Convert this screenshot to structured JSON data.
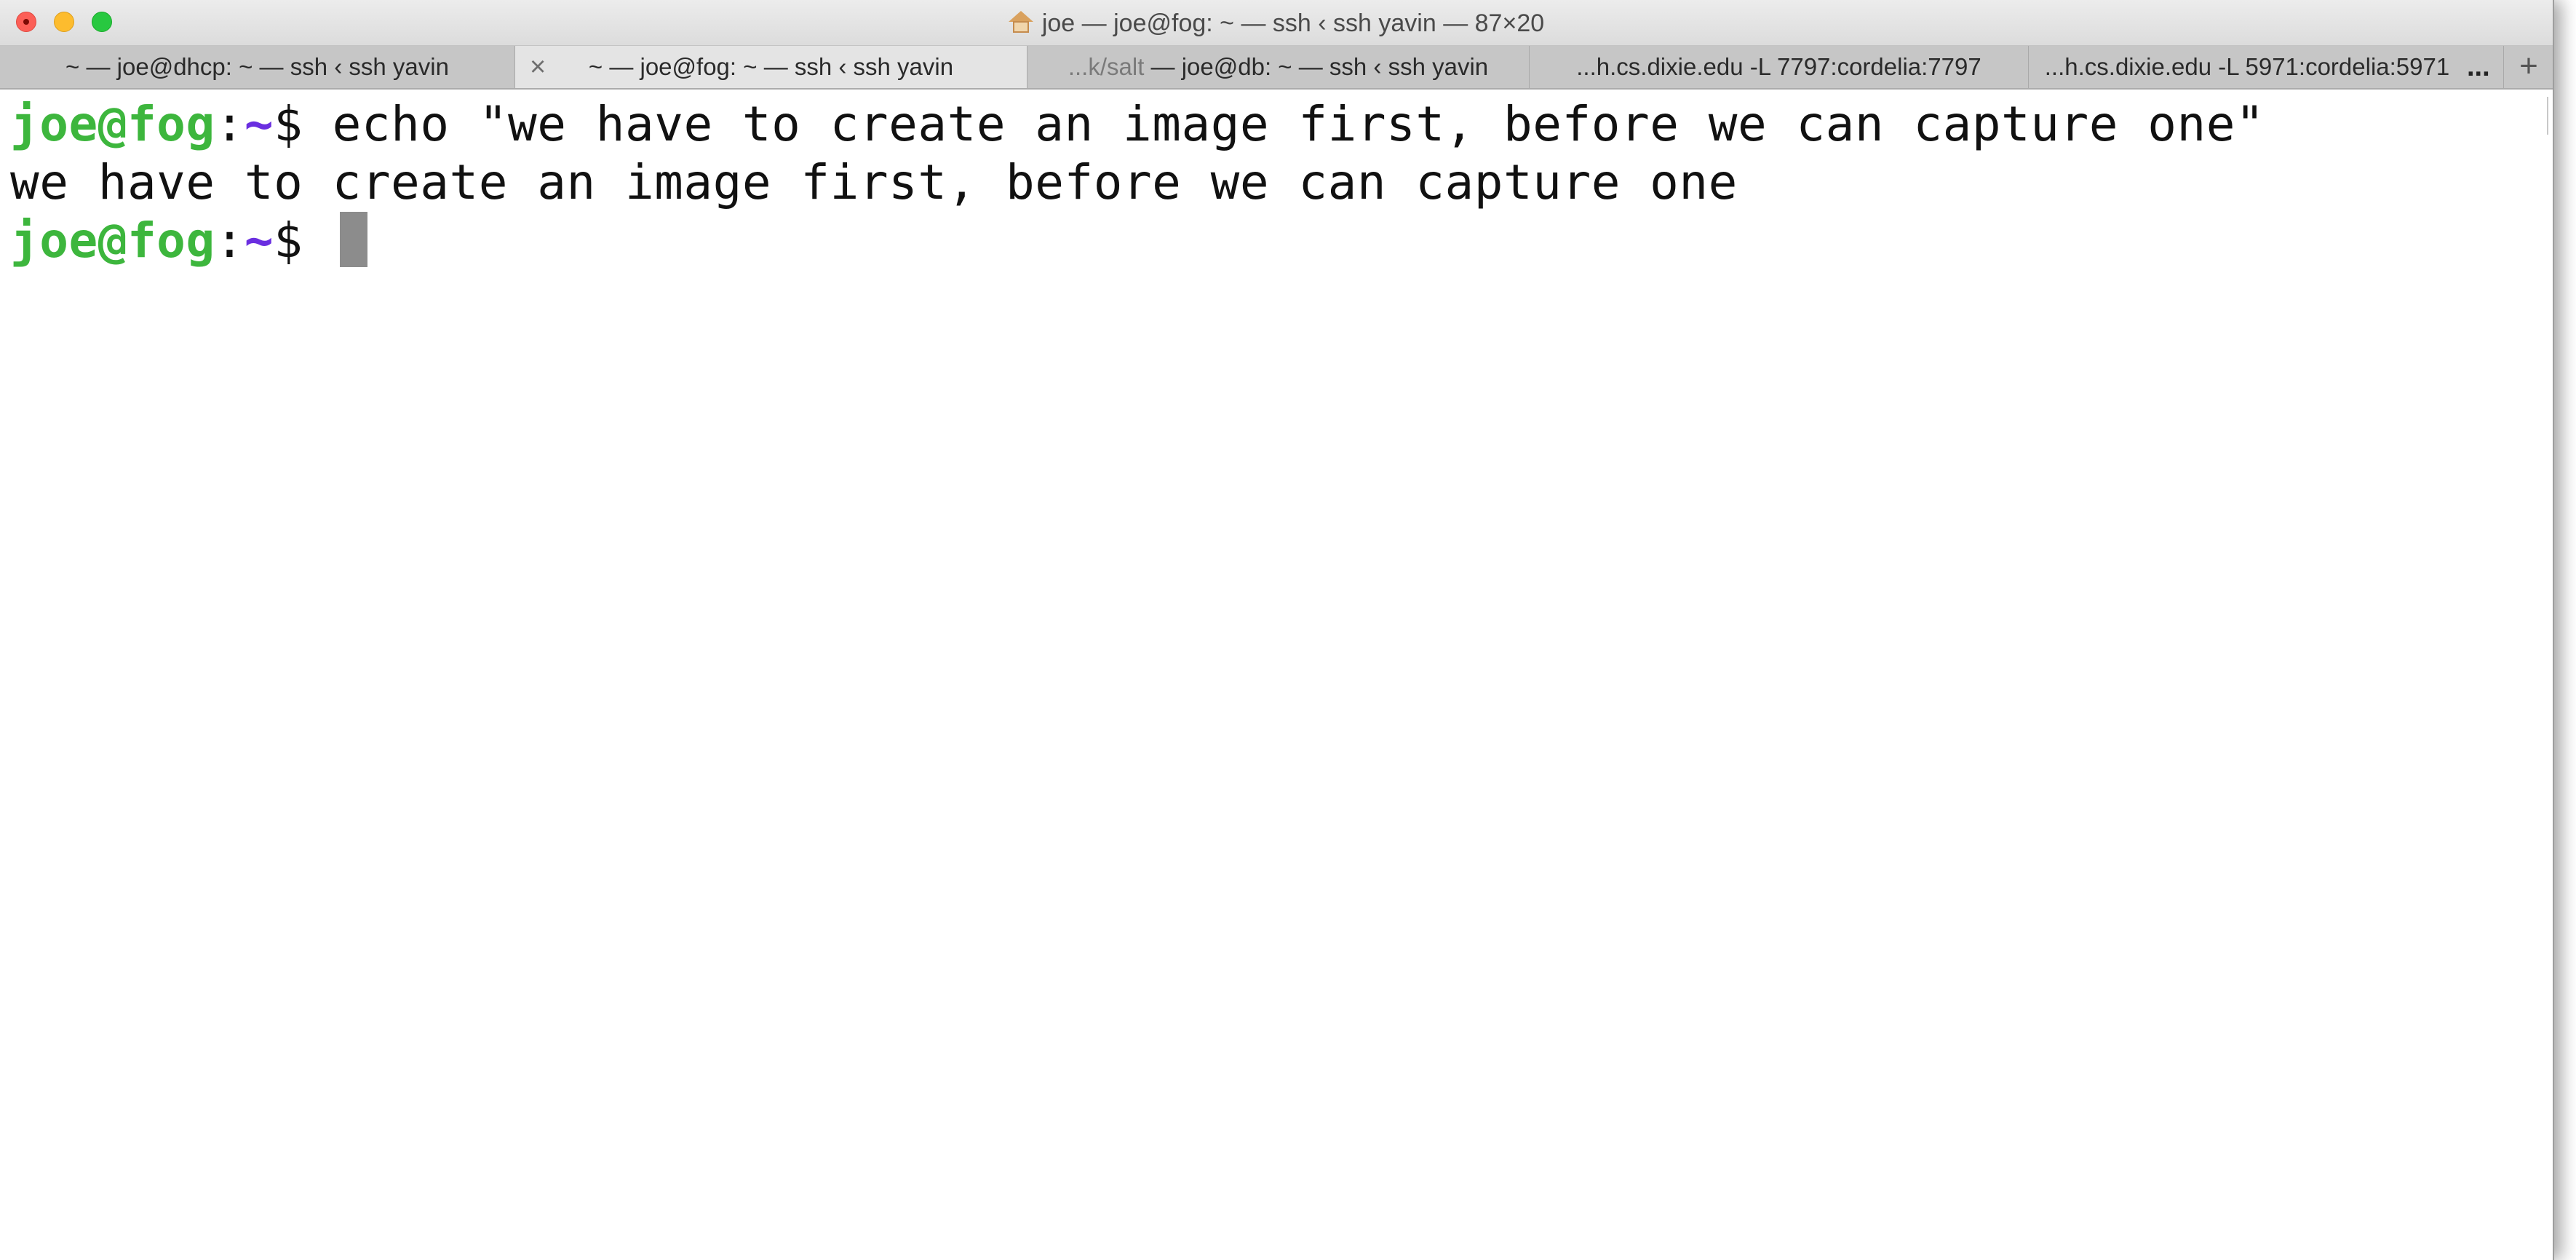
{
  "window": {
    "title": "joe — joe@fog: ~ — ssh ‹ ssh yavin — 87×20",
    "title_icon": "home-icon"
  },
  "tabs": [
    {
      "label": "~ — joe@dhcp: ~ — ssh ‹ ssh yavin",
      "active": false
    },
    {
      "label": "~ — joe@fog: ~ — ssh ‹ ssh yavin",
      "active": true,
      "close_glyph": "×"
    },
    {
      "dim_label": "...k/salt",
      "label": " — joe@db: ~ — ssh ‹ ssh yavin",
      "active": false
    },
    {
      "label": "...h.cs.dixie.edu -L 7797:cordelia:7797",
      "active": false
    },
    {
      "label": "...h.cs.dixie.edu -L 5971:cordelia:5971",
      "active": false
    }
  ],
  "tab_overflow": "...",
  "new_tab": "+",
  "terminal": {
    "prompt_user": "joe@fog",
    "prompt_sep": ":",
    "prompt_path": "~",
    "prompt_symbol": "$ ",
    "command": "echo \"we have to create an image first, before we can capture one\"",
    "output": "we have to create an image first, before we can capture one",
    "colors": {
      "user": "#3db63d",
      "path": "#6a2ee0",
      "cursor": "#8c8c8c"
    }
  }
}
